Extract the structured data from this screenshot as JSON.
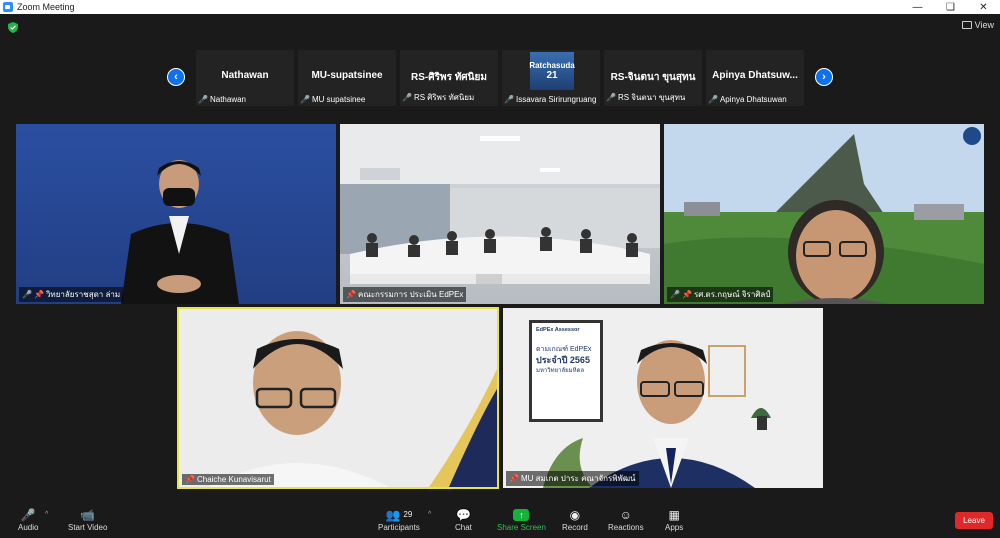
{
  "window": {
    "title": "Zoom Meeting"
  },
  "top": {
    "view_label": "View"
  },
  "strip": [
    {
      "name": "Nathawan",
      "label": "Nathawan"
    },
    {
      "name": "MU-supatsinee",
      "label": "MU supatsinee"
    },
    {
      "name": "RS-ศิริพร ทัศนิยม",
      "label": "RS ศิริพร ทัศนิยม"
    },
    {
      "name": "",
      "label": "Issavara Sirirungruang",
      "image_text": "Ratchasuda",
      "image_num": "21"
    },
    {
      "name": "RS-จินตนา ขุนสุทน",
      "label": "RS จินตนา ขุนสุทน"
    },
    {
      "name": "Apinya Dhatsuw...",
      "label": "Apinya Dhatsuwan"
    }
  ],
  "tiles": [
    {
      "label": "วิทยาลัยราชสุดา ล่าม"
    },
    {
      "label": "คณะกรรมการ ประเมิน EdPEx"
    },
    {
      "label": "รศ.ดร.กฤษณ์ จิราศิลป์"
    },
    {
      "label": "Chaiche  Kunavisarut"
    },
    {
      "label": "MU สมเกต ปาระ คณาจักรพิพัฒน์"
    }
  ],
  "slide_text": {
    "line1": "EdPEx Assessor",
    "line2": "ตามเกณฑ์ EdPEx",
    "line3": "ประจำปี 2565",
    "line4": "มหาวิทยาลัยมหิดล"
  },
  "controls": {
    "audio": "Audio",
    "video": "Start Video",
    "participants": "Participants",
    "participants_count": "29",
    "chat": "Chat",
    "share": "Share Screen",
    "record": "Record",
    "reactions": "Reactions",
    "apps": "Apps",
    "leave": "Leave"
  }
}
